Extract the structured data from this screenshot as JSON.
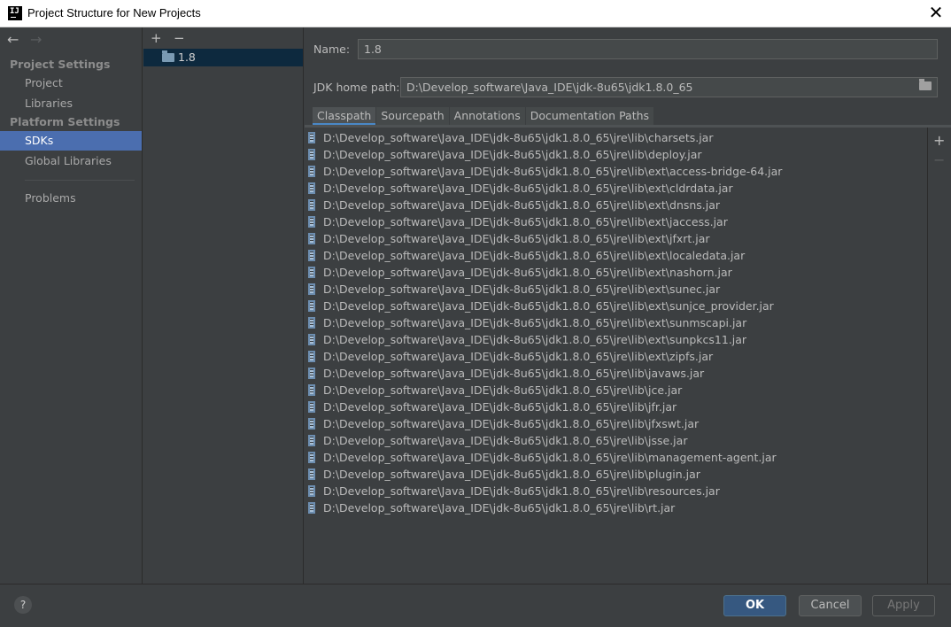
{
  "window": {
    "title": "Project Structure for New Projects",
    "app_icon": "IJ",
    "close_glyph": "✕"
  },
  "nav": {
    "back": "←",
    "forward": "→"
  },
  "sidebar": {
    "project_settings_header": "Project Settings",
    "project_items": [
      {
        "label": "Project"
      },
      {
        "label": "Libraries"
      }
    ],
    "platform_settings_header": "Platform Settings",
    "platform_items": [
      {
        "label": "SDKs",
        "selected": true
      },
      {
        "label": "Global Libraries"
      }
    ],
    "problems": "Problems"
  },
  "sdk_list": {
    "add": "+",
    "remove": "−",
    "items": [
      {
        "label": "1.8"
      }
    ]
  },
  "details": {
    "name_label": "Name:",
    "name_value": "1.8",
    "jdk_home_label": "JDK home path:",
    "jdk_home_value": "D:\\Develop_software\\Java_IDE\\jdk-8u65\\jdk1.8.0_65",
    "tabs": [
      {
        "label": "Classpath",
        "active": true
      },
      {
        "label": "Sourcepath"
      },
      {
        "label": "Annotations"
      },
      {
        "label": "Documentation Paths"
      }
    ],
    "classpath": [
      "D:\\Develop_software\\Java_IDE\\jdk-8u65\\jdk1.8.0_65\\jre\\lib\\charsets.jar",
      "D:\\Develop_software\\Java_IDE\\jdk-8u65\\jdk1.8.0_65\\jre\\lib\\deploy.jar",
      "D:\\Develop_software\\Java_IDE\\jdk-8u65\\jdk1.8.0_65\\jre\\lib\\ext\\access-bridge-64.jar",
      "D:\\Develop_software\\Java_IDE\\jdk-8u65\\jdk1.8.0_65\\jre\\lib\\ext\\cldrdata.jar",
      "D:\\Develop_software\\Java_IDE\\jdk-8u65\\jdk1.8.0_65\\jre\\lib\\ext\\dnsns.jar",
      "D:\\Develop_software\\Java_IDE\\jdk-8u65\\jdk1.8.0_65\\jre\\lib\\ext\\jaccess.jar",
      "D:\\Develop_software\\Java_IDE\\jdk-8u65\\jdk1.8.0_65\\jre\\lib\\ext\\jfxrt.jar",
      "D:\\Develop_software\\Java_IDE\\jdk-8u65\\jdk1.8.0_65\\jre\\lib\\ext\\localedata.jar",
      "D:\\Develop_software\\Java_IDE\\jdk-8u65\\jdk1.8.0_65\\jre\\lib\\ext\\nashorn.jar",
      "D:\\Develop_software\\Java_IDE\\jdk-8u65\\jdk1.8.0_65\\jre\\lib\\ext\\sunec.jar",
      "D:\\Develop_software\\Java_IDE\\jdk-8u65\\jdk1.8.0_65\\jre\\lib\\ext\\sunjce_provider.jar",
      "D:\\Develop_software\\Java_IDE\\jdk-8u65\\jdk1.8.0_65\\jre\\lib\\ext\\sunmscapi.jar",
      "D:\\Develop_software\\Java_IDE\\jdk-8u65\\jdk1.8.0_65\\jre\\lib\\ext\\sunpkcs11.jar",
      "D:\\Develop_software\\Java_IDE\\jdk-8u65\\jdk1.8.0_65\\jre\\lib\\ext\\zipfs.jar",
      "D:\\Develop_software\\Java_IDE\\jdk-8u65\\jdk1.8.0_65\\jre\\lib\\javaws.jar",
      "D:\\Develop_software\\Java_IDE\\jdk-8u65\\jdk1.8.0_65\\jre\\lib\\jce.jar",
      "D:\\Develop_software\\Java_IDE\\jdk-8u65\\jdk1.8.0_65\\jre\\lib\\jfr.jar",
      "D:\\Develop_software\\Java_IDE\\jdk-8u65\\jdk1.8.0_65\\jre\\lib\\jfxswt.jar",
      "D:\\Develop_software\\Java_IDE\\jdk-8u65\\jdk1.8.0_65\\jre\\lib\\jsse.jar",
      "D:\\Develop_software\\Java_IDE\\jdk-8u65\\jdk1.8.0_65\\jre\\lib\\management-agent.jar",
      "D:\\Develop_software\\Java_IDE\\jdk-8u65\\jdk1.8.0_65\\jre\\lib\\plugin.jar",
      "D:\\Develop_software\\Java_IDE\\jdk-8u65\\jdk1.8.0_65\\jre\\lib\\resources.jar",
      "D:\\Develop_software\\Java_IDE\\jdk-8u65\\jdk1.8.0_65\\jre\\lib\\rt.jar"
    ],
    "side_add": "+",
    "side_remove": "−"
  },
  "footer": {
    "help": "?",
    "ok": "OK",
    "cancel": "Cancel",
    "apply": "Apply"
  },
  "colors": {
    "background": "#3c3f41",
    "selection": "#4b6eaf",
    "sdk_selection": "#0d293e",
    "ok_button": "#365880"
  }
}
